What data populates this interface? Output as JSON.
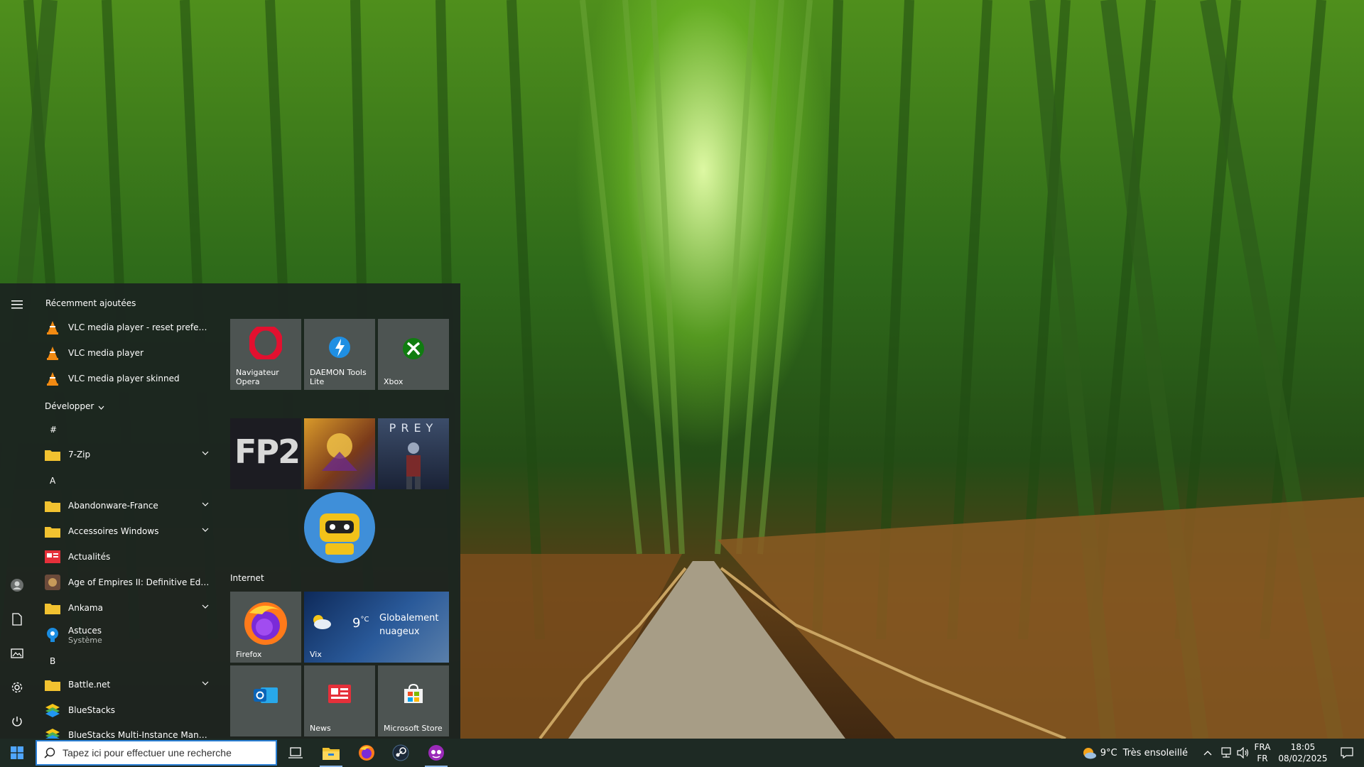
{
  "start_menu": {
    "recent_title": "Récemment ajoutées",
    "recent": [
      {
        "label": "VLC media player - reset preferences...",
        "icon": "vlc-icon"
      },
      {
        "label": "VLC media player",
        "icon": "vlc-icon"
      },
      {
        "label": "VLC media player skinned",
        "icon": "vlc-icon"
      }
    ],
    "expand_label": "Développer",
    "sections": {
      "hash": "#",
      "a": "A",
      "b": "B"
    },
    "apps": [
      {
        "label": "7-Zip",
        "icon": "folder-icon",
        "expandable": true
      },
      {
        "label": "Abandonware-France",
        "icon": "folder-icon",
        "expandable": true
      },
      {
        "label": "Accessoires Windows",
        "icon": "folder-icon",
        "expandable": true
      },
      {
        "label": "Actualités",
        "icon": "news-icon",
        "expandable": false
      },
      {
        "label": "Age of Empires II: Definitive Edition",
        "icon": "aoe-icon",
        "expandable": false
      },
      {
        "label": "Ankama",
        "icon": "folder-icon",
        "expandable": true
      },
      {
        "label": "Astuces",
        "sublabel": "Système",
        "icon": "tips-icon",
        "expandable": false
      },
      {
        "label": "Battle.net",
        "icon": "folder-icon",
        "expandable": true
      },
      {
        "label": "BlueStacks",
        "icon": "bluestacks-icon",
        "expandable": false
      },
      {
        "label": "BlueStacks Multi-Instance Manager",
        "icon": "bluestacks-icon",
        "expandable": false
      }
    ]
  },
  "tiles": {
    "row1": [
      {
        "label": "Navigateur Opera",
        "icon": "opera-icon"
      },
      {
        "label": "DAEMON Tools Lite",
        "icon": "daemon-tools-icon"
      },
      {
        "label": "Xbox",
        "icon": "xbox-icon"
      }
    ],
    "games": [
      {
        "label": "FP2",
        "icon": "fp2-tile"
      },
      {
        "label": "",
        "icon": "game-art-tile"
      },
      {
        "label": "PREY",
        "icon": "prey-tile"
      },
      {
        "label": "",
        "icon": "robot-game-tile"
      }
    ],
    "internet_title": "Internet",
    "internet": [
      {
        "label": "Firefox",
        "icon": "firefox-icon"
      },
      {
        "label": "Vix",
        "icon": "weather-icon",
        "temp": "9",
        "unit": "°C",
        "condition": "Globalement nuageux"
      }
    ],
    "row4": [
      {
        "label": "",
        "icon": "outlook-icon"
      },
      {
        "label": "News",
        "icon": "news-icon"
      },
      {
        "label": "Microsoft Store",
        "icon": "store-icon"
      }
    ]
  },
  "taskbar": {
    "search_placeholder": "Tapez ici pour effectuer une recherche",
    "weather": {
      "temp": "9°C",
      "condition": "Très ensoleillé"
    },
    "lang": {
      "line1": "FRA",
      "line2": "FR"
    },
    "clock": {
      "time": "18:05",
      "date": "08/02/2025"
    }
  },
  "colors": {
    "accent": "#2a7fd4",
    "tile_bg": "#4d5452",
    "menu_bg": "#1c2420",
    "taskbar_bg": "#1e2a24"
  }
}
